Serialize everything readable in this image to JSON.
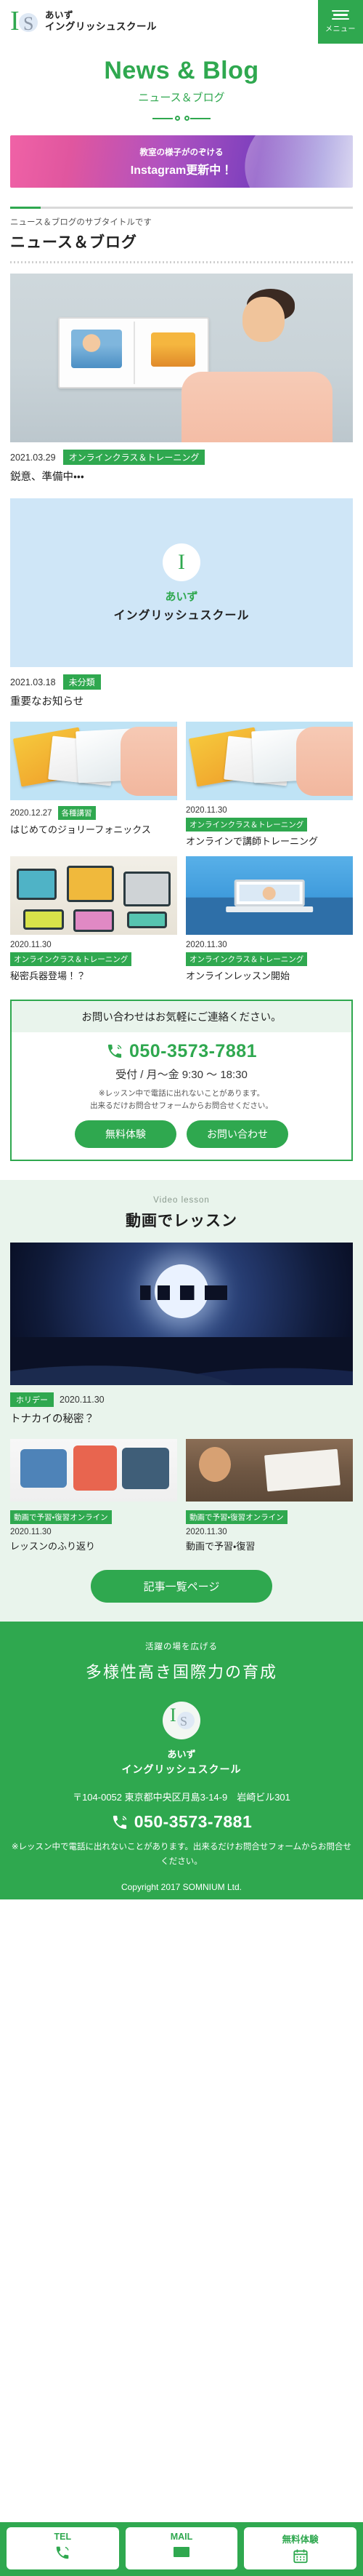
{
  "header": {
    "brand_line1": "あいず",
    "brand_line2": "イングリッシュスクール",
    "menu_label": "メニュー",
    "menu_icon": "hamburger-icon",
    "logo_i": "I",
    "logo_s": "S"
  },
  "hero": {
    "title": "News & Blog",
    "subtitle": "ニュース＆ブログ"
  },
  "banner": {
    "line1": "教室の様子がのぞける",
    "line2": "Instagram更新中！"
  },
  "news_section": {
    "subtitle": "ニュース＆ブログのサブタイトルです",
    "heading": "ニュース＆ブログ"
  },
  "posts": [
    {
      "date": "2021.03.29",
      "tag": "オンラインクラス＆トレーニング",
      "title": "鋭意、準備中・・・",
      "thumb": "teacher-with-picture-book-photo"
    },
    {
      "date": "2021.03.18",
      "tag": "未分類",
      "title": "重要なお知らせ",
      "thumb": "school-logo-card"
    }
  ],
  "post_grid": [
    {
      "date": "2020.12.27",
      "tag": "各種講習",
      "title": "はじめてのジョリーフォニックス",
      "thumb": "jolly-phonics-books-photo"
    },
    {
      "date": "2020.11.30",
      "tag": "オンラインクラス＆トレーニング",
      "title": "オンラインで講師トレーニング",
      "thumb": "jolly-phonics-books-photo"
    },
    {
      "date": "2020.11.30",
      "tag": "オンラインクラス＆トレーニング",
      "title": "秘密兵器登場！？",
      "thumb": "retro-cameras-photo"
    },
    {
      "date": "2020.11.30",
      "tag": "オンラインクラス＆トレーニング",
      "title": "オンラインレッスン開始",
      "thumb": "online-lesson-desk-photo"
    }
  ],
  "contact": {
    "heading": "お問い合わせはお気軽にご連絡ください。",
    "phone": "050-3573-7881",
    "phone_icon": "phone-icon",
    "hours": "受付 / 月～金 9:30 ～ 18:30",
    "note_line1": "※レッスン中で電話に出れないことがあります。",
    "note_line2": "出来るだけお問合せフォームからお問合せください。",
    "button_trial": "無料体験",
    "button_contact": "お問い合わせ"
  },
  "video_section": {
    "eyebrow": "Video lesson",
    "heading": "動画でレッスン",
    "featured": {
      "tag": "ホリデー",
      "date": "2020.11.30",
      "title": "トナカイの秘密？",
      "thumb": "santa-sleigh-night-sky-video"
    },
    "items": [
      {
        "tag": "動画で予習・復習オンライン",
        "date": "2020.11.30",
        "title": "レッスンのふり返り",
        "thumb": "illustration-kids-lesson-video"
      },
      {
        "tag": "動画で予習・復習オンライン",
        "date": "2020.11.30",
        "title": "動画で予習・復習",
        "thumb": "desk-study-laptop-video"
      }
    ],
    "list_button": "記事一覧ページ"
  },
  "footer": {
    "tagline": "活躍の場を広げる",
    "headline": "多様性高き国際力の育成",
    "logo_i": "I",
    "logo_s": "S",
    "name_line1": "あいず",
    "name_line2": "イングリッシュスクール",
    "address": "〒104-0052 東京都中央区月島3-14-9　岩崎ビル301",
    "phone": "050-3573-7881",
    "phone_icon": "phone-icon",
    "note": "※レッスン中で電話に出れないことがあります。出来るだけお問合せフォームからお問合せください。",
    "copyright": "Copyright 2017 SOMNIUM Ltd."
  },
  "bottom_bar": [
    {
      "label": "TEL",
      "icon": "phone-icon"
    },
    {
      "label": "MAIL",
      "icon": "mail-icon"
    },
    {
      "label": "無料体験",
      "icon": "calendar-icon"
    }
  ],
  "colors": {
    "brand_green": "#2fa84f",
    "light_green_bg": "#e9f4ec",
    "banner_pink": "#f062a6",
    "banner_purple": "#7b3fbd"
  }
}
